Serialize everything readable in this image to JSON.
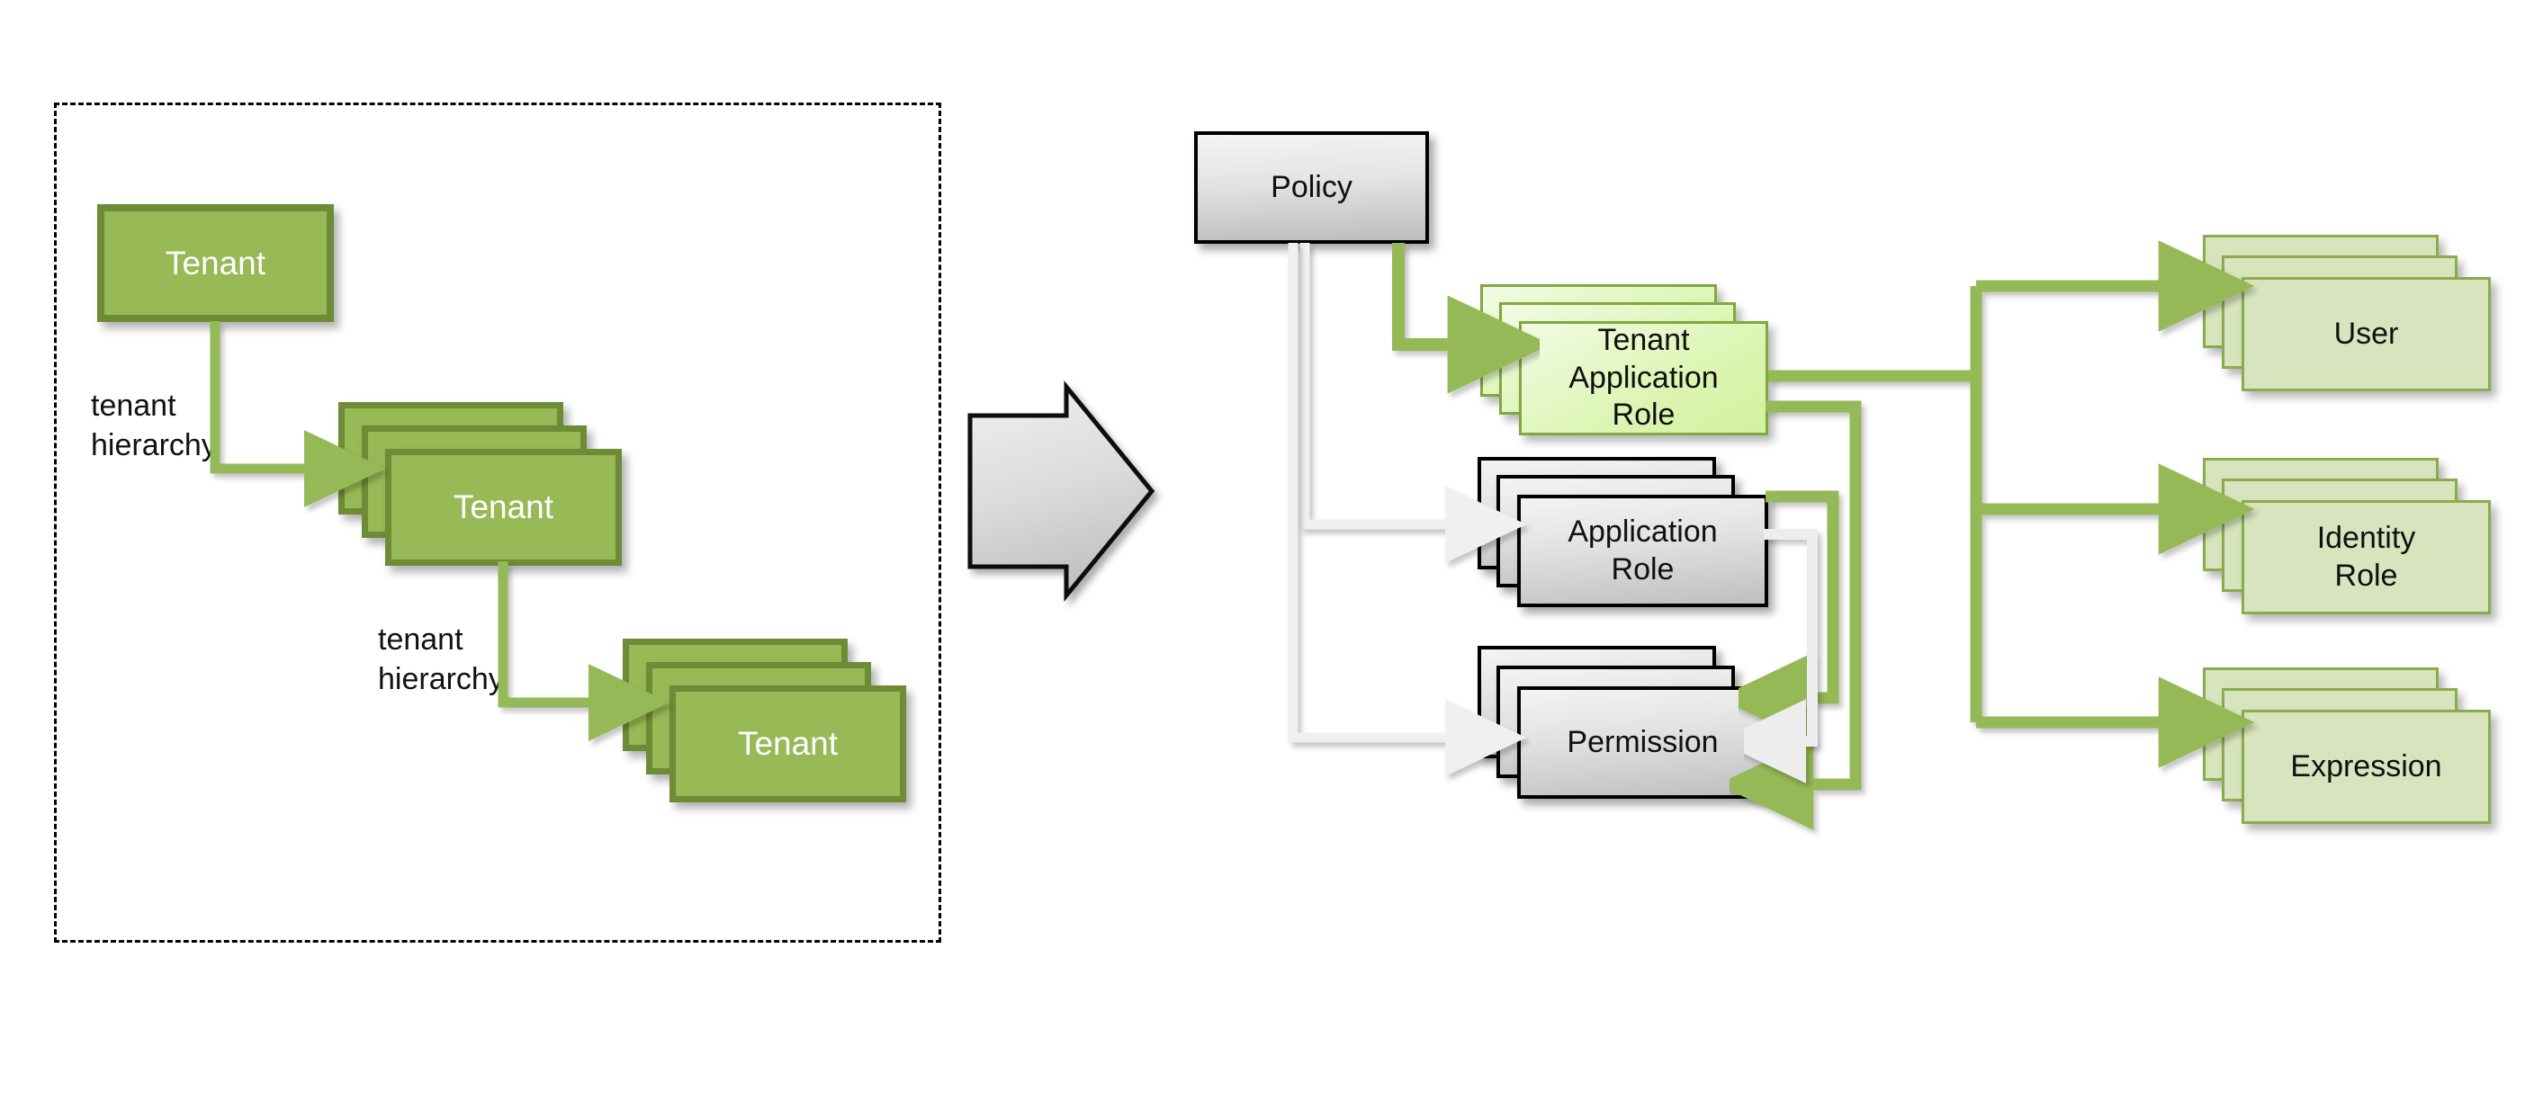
{
  "diagram": {
    "title": "Tenant hierarchy to policy model transformation",
    "colors": {
      "olive_fill": "#97b956",
      "olive_border": "#6e8b35",
      "bright_green_fill": "#d2f29e",
      "bright_green_border": "#7fa93f",
      "sage_fill": "#d7e4bd",
      "sage_border": "#8aab4e",
      "gray_fill": "#bfbfbf",
      "black_border": "#000000",
      "green_connector": "#94b956",
      "white_connector": "#f2f2f2"
    }
  },
  "left_panel": {
    "frame": "dashed-group",
    "nodes": [
      {
        "id": "tenant-root",
        "label": "Tenant",
        "style": "olive-single"
      },
      {
        "id": "tenant-mid",
        "label": "Tenant",
        "style": "olive-stack"
      },
      {
        "id": "tenant-leaf",
        "label": "Tenant",
        "style": "olive-stack"
      }
    ],
    "edges": [
      {
        "id": "edge-tenant-hierarchy-1",
        "label": "tenant\nhierarchy",
        "from": "tenant-root",
        "to": "tenant-mid"
      },
      {
        "id": "edge-tenant-hierarchy-2",
        "label": "tenant\nhierarchy",
        "from": "tenant-mid",
        "to": "tenant-leaf"
      }
    ]
  },
  "transform_arrow": {
    "name": "block-arrow-right",
    "direction": "right"
  },
  "right_panel": {
    "nodes": [
      {
        "id": "policy",
        "label": "Policy",
        "style": "gray-single"
      },
      {
        "id": "tenant-app-role",
        "label": "Tenant\nApplication\nRole",
        "style": "bright-green-stack"
      },
      {
        "id": "application-role",
        "label": "Application\nRole",
        "style": "gray-stack"
      },
      {
        "id": "permission",
        "label": "Permission",
        "style": "gray-stack"
      },
      {
        "id": "user",
        "label": "User",
        "style": "sage-stack"
      },
      {
        "id": "identity-role",
        "label": "Identity\nRole",
        "style": "sage-stack"
      },
      {
        "id": "expression",
        "label": "Expression",
        "style": "sage-stack"
      }
    ],
    "edges": [
      {
        "from": "policy",
        "to": "tenant-app-role",
        "color": "green"
      },
      {
        "from": "policy",
        "to": "application-role",
        "color": "white"
      },
      {
        "from": "policy",
        "to": "permission",
        "color": "white"
      },
      {
        "from": "tenant-app-role",
        "to": "user",
        "color": "green"
      },
      {
        "from": "tenant-app-role",
        "to": "identity-role",
        "color": "green"
      },
      {
        "from": "tenant-app-role",
        "to": "expression",
        "color": "green"
      },
      {
        "from": "tenant-app-role",
        "to": "permission",
        "color": "green"
      },
      {
        "from": "application-role",
        "to": "permission",
        "color": "green"
      },
      {
        "from": "application-role",
        "to": "permission",
        "color": "white"
      }
    ]
  },
  "labels": {
    "tenant": "Tenant",
    "tenant_hierarchy": "tenant\nhierarchy",
    "policy": "Policy",
    "tenant_application_role": "Tenant\nApplication\nRole",
    "application_role": "Application\nRole",
    "permission": "Permission",
    "user": "User",
    "identity_role": "Identity\nRole",
    "expression": "Expression"
  }
}
